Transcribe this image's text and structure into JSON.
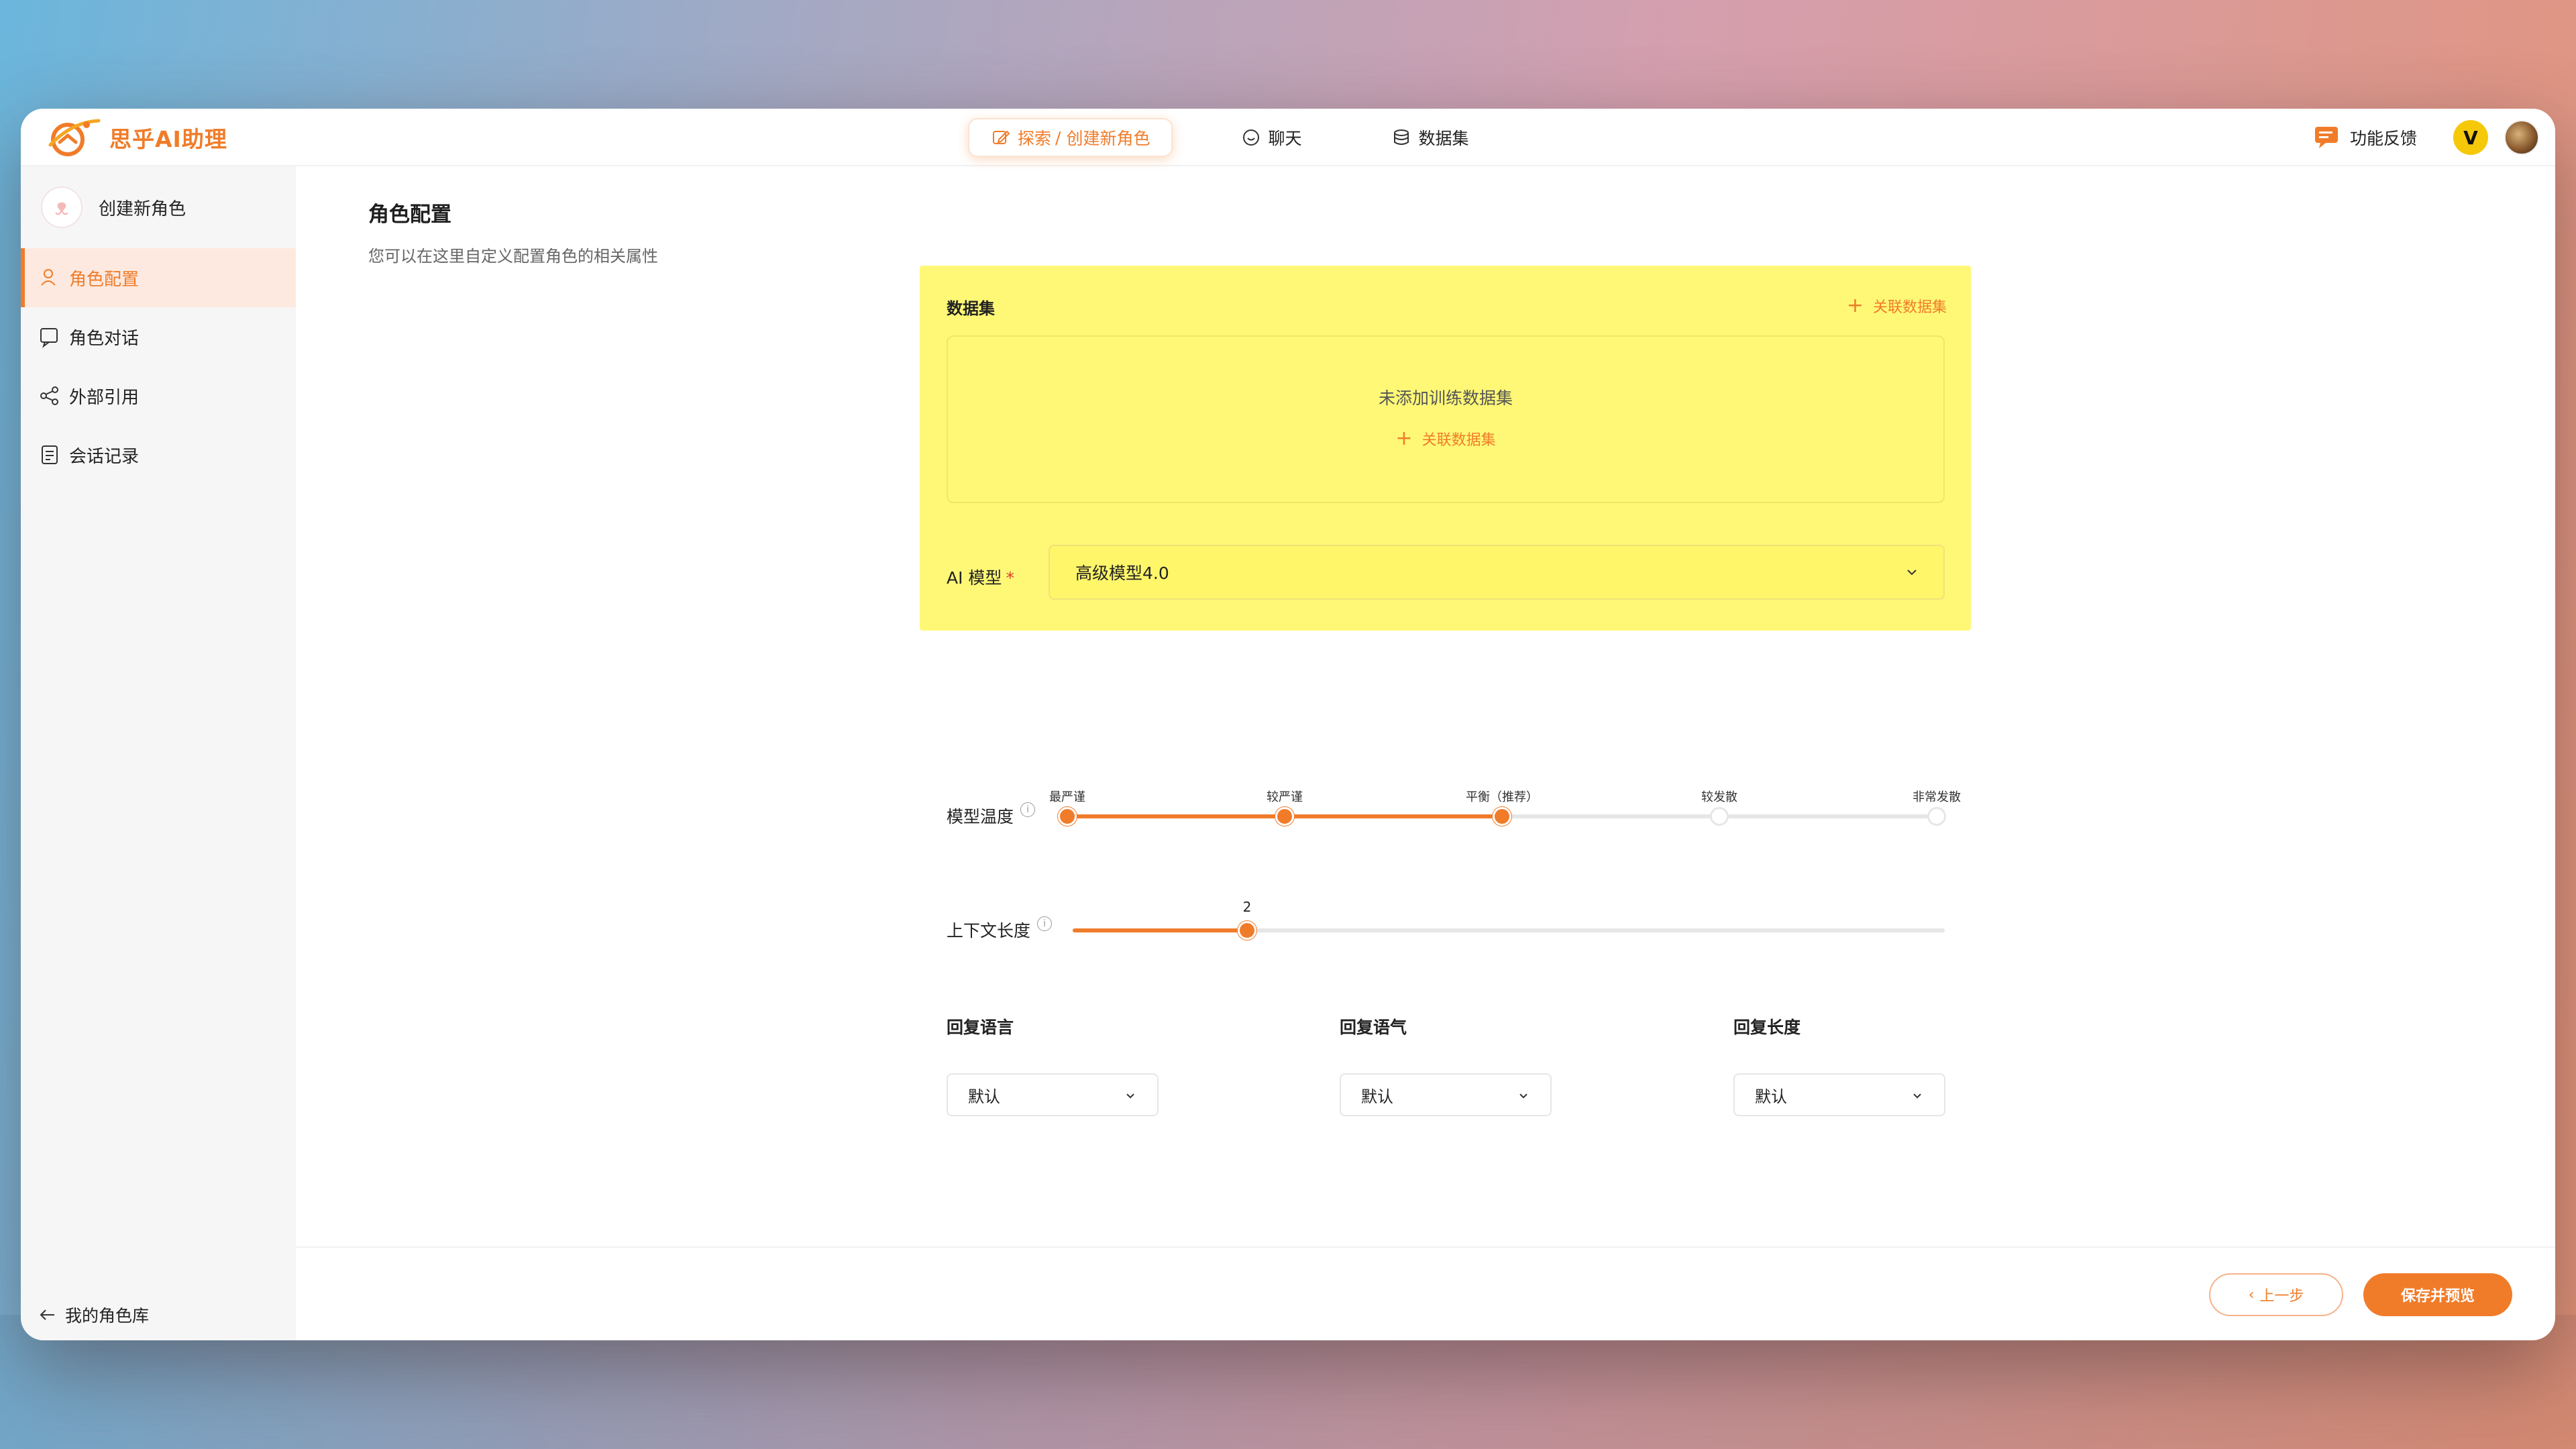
{
  "app": {
    "name": "思乎AI助理"
  },
  "nav": {
    "tabs": [
      {
        "label": "探索",
        "icon": "edit-icon"
      },
      {
        "label": "聊天",
        "icon": "chat-icon"
      },
      {
        "label": "数据集",
        "icon": "database-icon"
      }
    ],
    "breadcrumb_sep": "/",
    "breadcrumb_current": "创建新角色"
  },
  "top_right": {
    "feedback": "功能反馈",
    "vip_badge": "V"
  },
  "sidebar": {
    "title": "创建新角色",
    "items": [
      {
        "label": "角色配置",
        "icon": "user-icon",
        "active": true
      },
      {
        "label": "角色对话",
        "icon": "chat-bubble-icon"
      },
      {
        "label": "外部引用",
        "icon": "share-icon"
      },
      {
        "label": "会话记录",
        "icon": "document-icon"
      }
    ],
    "back": "我的角色库"
  },
  "main": {
    "title": "角色配置",
    "subtitle": "您可以在这里自定义配置角色的相关属性",
    "dataset": {
      "label": "数据集",
      "link": "关联数据集",
      "empty": "未添加训练数据集",
      "empty_link": "关联数据集"
    },
    "model": {
      "label": "AI 模型",
      "required": "*",
      "value": "高级模型4.0"
    },
    "temperature": {
      "label": "模型温度",
      "info": "i",
      "options": [
        "最严谨",
        "较严谨",
        "平衡（推荐）",
        "较发散",
        "非常发散"
      ],
      "selected_index": 2
    },
    "context": {
      "label": "上下文长度",
      "info": "i",
      "value": "2",
      "fraction": 0.2
    },
    "reply": [
      {
        "label": "回复语言",
        "value": "默认"
      },
      {
        "label": "回复语气",
        "value": "默认"
      },
      {
        "label": "回复长度",
        "value": "默认"
      }
    ]
  },
  "footer": {
    "prev": "上一步",
    "prev_icon": "‹",
    "save": "保存并预览"
  },
  "colors": {
    "accent": "#f07c2a",
    "highlight": "#fff876"
  }
}
